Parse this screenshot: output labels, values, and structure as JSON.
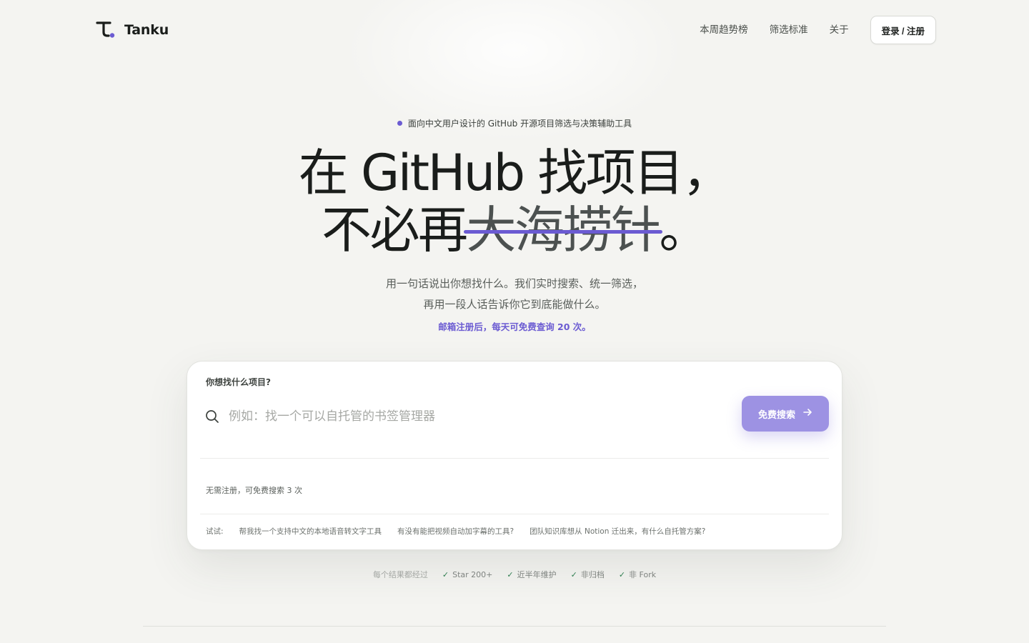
{
  "brand": {
    "name": "Tanku"
  },
  "nav": {
    "items": [
      "本周趋势榜",
      "筛选标准",
      "关于"
    ],
    "login_label": "登录 / 注册"
  },
  "hero": {
    "tagline": "面向中文用户设计的 GitHub 开源项目筛选与决策辅助工具",
    "headline_line1": "在 GitHub 找项目，",
    "headline_line2_prefix": "不必再",
    "headline_line2_strike": "大海捞针",
    "headline_line2_suffix": "。",
    "subtitle_line1": "用一句话说出你想找什么。我们实时搜索、统一筛选，",
    "subtitle_line2": "再用一段人话告诉你它到底能做什么。",
    "promo": "邮箱注册后，每天可免费查询 20 次。"
  },
  "search": {
    "label": "你想找什么项目?",
    "placeholder": "例如：找一个可以自托管的书签管理器",
    "button_label": "免费搜索",
    "free_note": "无需注册，可免费搜索 3 次",
    "try_label": "试试:",
    "suggestions": [
      "帮我找一个支持中文的本地语音转文字工具",
      "有没有能把视频自动加字幕的工具?",
      "团队知识库想从 Notion 迁出来，有什么自托管方案?"
    ]
  },
  "criteria": {
    "intro": "每个结果都经过",
    "items": [
      "Star 200+",
      "近半年维护",
      "非归档",
      "非 Fork"
    ]
  },
  "colors": {
    "accent": "#6b5bd2",
    "button": "#9d92e3",
    "check": "#2e7d4f"
  }
}
